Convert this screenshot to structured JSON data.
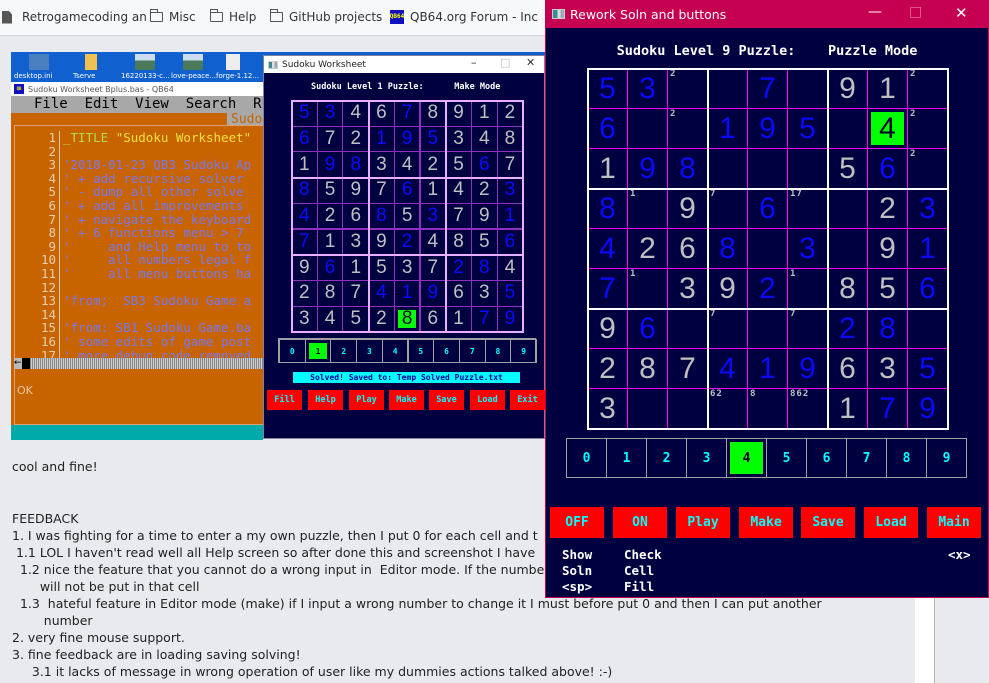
{
  "bookmarks": [
    {
      "label": "Retrogamecoding an",
      "icon": "file-icon"
    },
    {
      "label": "Misc",
      "icon": "folder-icon"
    },
    {
      "label": "Help",
      "icon": "folder-icon"
    },
    {
      "label": "GitHub projects",
      "icon": "folder-icon"
    },
    {
      "label": "QB64.org Forum - Inc",
      "icon": "qb64-icon"
    }
  ],
  "desktop_icons": [
    "desktop.ini",
    "Tserve",
    "16220133-c...",
    "love-peace...",
    "forge-1.12..."
  ],
  "qb64": {
    "title": "Sudoku Worksheet Bplus.bas - QB64",
    "menu": "File  Edit  View  Search  Ru",
    "tab": "Sudo",
    "status": "OK",
    "lines": [
      {
        "n": "1",
        "t": "_TITLE ",
        "s": "\"Sudoku Worksheet\""
      },
      {
        "n": "2",
        "c": ""
      },
      {
        "n": "3",
        "c": "'2018-01-23 QB3 Sudoku Ap"
      },
      {
        "n": "4",
        "c": "' + add recursive solver"
      },
      {
        "n": "5",
        "c": "' - dump all other solve"
      },
      {
        "n": "6",
        "c": "' + add all improvements"
      },
      {
        "n": "7",
        "c": "' + navigate the keyboard"
      },
      {
        "n": "8",
        "c": "' + 6 functions menu > 7"
      },
      {
        "n": "9",
        "c": "'     and Help menu to to"
      },
      {
        "n": "10",
        "c": "'     all numbers legal f"
      },
      {
        "n": "11",
        "c": "'     all menu buttons ha"
      },
      {
        "n": "12",
        "c": ""
      },
      {
        "n": "13",
        "c": "'from;  SB3 Sudoku Game a"
      },
      {
        "n": "14",
        "c": ""
      },
      {
        "n": "15",
        "c": "'from: SB1 Sudoku Game.ba"
      },
      {
        "n": "16",
        "c": "' some edits of game post"
      },
      {
        "n": "17",
        "c": "' more debug code removed"
      }
    ]
  },
  "worksheet": {
    "title": "Sudoku Worksheet",
    "heading": "Sudoku Level 1 Puzzle:      Make Mode",
    "grid": [
      [
        "5b",
        "3b",
        "4g",
        "6g",
        "7b",
        "8g",
        "9g",
        "1g",
        "2g"
      ],
      [
        "6b",
        "7g",
        "2g",
        "1b",
        "9b",
        "5b",
        "3g",
        "4g",
        "8g"
      ],
      [
        "1g",
        "9b",
        "8b",
        "3g",
        "4g",
        "2g",
        "5g",
        "6b",
        "7g"
      ],
      [
        "8b",
        "5g",
        "9g",
        "7g",
        "6b",
        "1g",
        "4g",
        "2g",
        "3b"
      ],
      [
        "4b",
        "2g",
        "6g",
        "8b",
        "5g",
        "3b",
        "7g",
        "9g",
        "1b"
      ],
      [
        "7b",
        "1g",
        "3g",
        "9g",
        "2b",
        "4g",
        "8g",
        "5g",
        "6b"
      ],
      [
        "9g",
        "6b",
        "1g",
        "5g",
        "3g",
        "7g",
        "2b",
        "8b",
        "4g"
      ],
      [
        "2g",
        "8g",
        "7g",
        "4b",
        "1b",
        "9b",
        "6g",
        "3g",
        "5b"
      ],
      [
        "3g",
        "4g",
        "5g",
        "2g",
        "8s",
        "6g",
        "1g",
        "7b",
        "9b"
      ]
    ],
    "digits": [
      "0",
      "1",
      "2",
      "3",
      "4",
      "5",
      "6",
      "7",
      "8",
      "9"
    ],
    "selected_digit": "1",
    "status": "Solved! Saved to: Temp Solved Puzzle.txt",
    "buttons": [
      "Fill",
      "Help",
      "Play",
      "Make",
      "Save",
      "Load",
      "Exit"
    ]
  },
  "rework": {
    "title": "Rework Soln and buttons",
    "heading": "Sudoku Level 9 Puzzle:    Puzzle Mode",
    "grid": [
      [
        "5b",
        "3b",
        "m:2",
        "",
        "7b",
        "",
        "9g",
        "1g",
        "m:2"
      ],
      [
        "6b",
        "",
        "m:2",
        "1b",
        "9b",
        "5b",
        "",
        "4s",
        "m:2"
      ],
      [
        "1g",
        "9b",
        "8b",
        "",
        "",
        "",
        "5g",
        "6b",
        "m:2"
      ],
      [
        "8b",
        "m:1",
        "9g",
        "m:7",
        "6b",
        "m:17",
        "",
        "2g",
        "3b"
      ],
      [
        "4b",
        "2g",
        "6g",
        "8b",
        "",
        "3b",
        "",
        "9g",
        "1b"
      ],
      [
        "7b",
        "m:1",
        "3g",
        "9g",
        "2b",
        "m:1",
        "8g",
        "5g",
        "6b"
      ],
      [
        "9g",
        "6b",
        "",
        "m:7",
        "",
        "m:7",
        "2b",
        "8b",
        ""
      ],
      [
        "2g",
        "8g",
        "7g",
        "4b",
        "1b",
        "9b",
        "6g",
        "3g",
        "5b"
      ],
      [
        "3g",
        "",
        "",
        "m:62",
        "m:8",
        "m:862",
        "1g",
        "7b",
        "9b"
      ]
    ],
    "digits": [
      "0",
      "1",
      "2",
      "3",
      "4",
      "5",
      "6",
      "7",
      "8",
      "9"
    ],
    "selected_digit": "4",
    "buttons": [
      "OFF",
      "ON",
      "Play",
      "Make",
      "Save",
      "Load",
      "Main"
    ],
    "help": {
      "col1": [
        "Show",
        "Soln",
        "<sp>"
      ],
      "col2": [
        "Check",
        "Cell",
        "Fill"
      ],
      "exit": "<x>"
    }
  },
  "post": {
    "lines": [
      "cool and fine!",
      "FEEDBACK",
      "1. I was fighting for a time to enter a my own puzzle, then I put 0 for each cell and t",
      " 1.1 LOL I haven't read well all Help screen so after done this and screenshot I have",
      "  1.2 nice the feature that you cannot do a wrong input in  Editor mode. If the numbe",
      "       will not be put in that cell",
      "  1.3  hateful feature in Editor mode (make) if I input a wrong number to change it I must before put 0 and then I can put another",
      "        number",
      "2. very fine mouse support.",
      "3. fine feedback are in loading saving solving!",
      "     3.1 it lacks of message in wrong operation of user like my dummies actions talked above! :-)"
    ]
  },
  "colors": {
    "given": "#c0c0c0",
    "entered": "#0a0aff",
    "selected": "#00ff00",
    "button": "#ff0000",
    "button_text": "#00ffff",
    "window_bg": "#000040",
    "title_bar": "#c50050"
  }
}
